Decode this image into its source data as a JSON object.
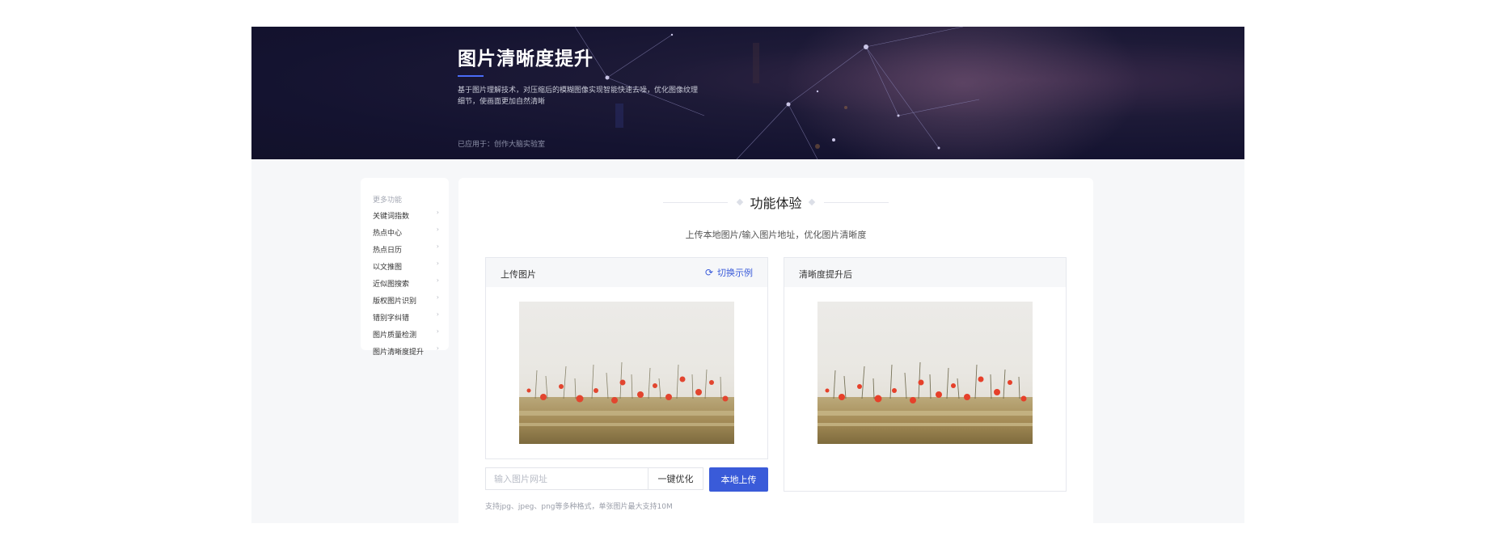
{
  "banner": {
    "title": "图片清晰度提升",
    "description": "基于图片理解技术，对压缩后的模糊图像实现智能快速去噪，优化图像纹理细节，使画面更加自然清晰",
    "applied_to": "已应用于：创作大脑实验室"
  },
  "sidebar": {
    "title": "更多功能",
    "items": [
      {
        "label": "关键词指数"
      },
      {
        "label": "热点中心"
      },
      {
        "label": "热点日历"
      },
      {
        "label": "以文推图"
      },
      {
        "label": "近似图搜索"
      },
      {
        "label": "版权图片识别"
      },
      {
        "label": "错别字纠错"
      },
      {
        "label": "图片质量检测"
      },
      {
        "label": "图片清晰度提升"
      }
    ],
    "chevron": "›"
  },
  "main": {
    "section_title": "功能体验",
    "subtitle": "上传本地图片/输入图片地址，优化图片清晰度",
    "upload_panel": {
      "label": "上传图片",
      "switch_label": "切换示例",
      "switch_icon": "refresh-icon"
    },
    "result_panel": {
      "label": "清晰度提升后"
    },
    "url_input": {
      "placeholder": "输入图片网址",
      "value": ""
    },
    "optimize_label": "一键优化",
    "upload_label": "本地上传",
    "hint": "支持jpg、jpeg、png等多种格式，单张图片最大支持10M"
  },
  "colors": {
    "accent": "#3a5bd9",
    "banner_bg": "#141330"
  }
}
